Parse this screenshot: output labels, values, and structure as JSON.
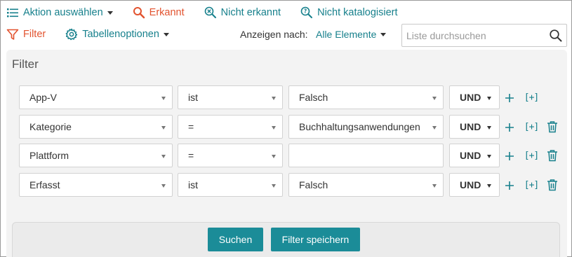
{
  "toolbar": {
    "action": "Aktion auswählen",
    "recognized": "Erkannt",
    "not_recognized": "Nicht erkannt",
    "not_cataloged": "Nicht katalogisiert"
  },
  "row2": {
    "filter": "Filter",
    "table_options": "Tabellenoptionen",
    "show_by_label": "Anzeigen nach:",
    "show_by_value": "Alle Elemente",
    "search_placeholder": "Liste durchsuchen"
  },
  "panel": {
    "title": "Filter",
    "rows": [
      {
        "field": "App-V",
        "operator": "ist",
        "value": "Falsch",
        "logic": "UND",
        "deletable": false
      },
      {
        "field": "Kategorie",
        "operator": "=",
        "value": "Buchhaltungsanwendungen",
        "logic": "UND",
        "deletable": true
      },
      {
        "field": "Plattform",
        "operator": "=",
        "value": "",
        "logic": "UND",
        "deletable": true
      },
      {
        "field": "Erfasst",
        "operator": "ist",
        "value": "Falsch",
        "logic": "UND",
        "deletable": true
      }
    ],
    "add_symbol": "+",
    "add_group_symbol": "[+]",
    "search_button": "Suchen",
    "save_filter_button": "Filter speichern"
  },
  "colors": {
    "accent": "#17808c",
    "orange": "#e2532f",
    "button": "#1b8c98"
  }
}
